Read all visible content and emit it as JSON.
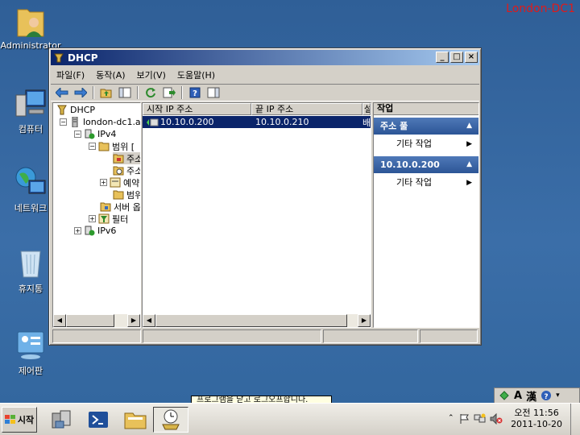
{
  "host_label": "London-DC1",
  "desktop_icons": [
    {
      "label": "Administrator"
    },
    {
      "label": "컴퓨터"
    },
    {
      "label": "네트워크"
    },
    {
      "label": "휴지통"
    },
    {
      "label": "제어판"
    }
  ],
  "window": {
    "title": "DHCP",
    "buttons": {
      "minimize": "_",
      "maximize": "□",
      "close": "×"
    }
  },
  "menu": [
    "파일(F)",
    "동작(A)",
    "보기(V)",
    "도움말(H)"
  ],
  "tree": {
    "root": "DHCP",
    "server": "london-dc1.a",
    "ipv4": "IPv4",
    "scope": "범위 [",
    "address_pool": "주소",
    "leases": "주소",
    "reservations": "예약",
    "scope_options": "범위",
    "server_options": "서버 옵",
    "filters": "필터",
    "ipv6": "IPv6"
  },
  "list": {
    "columns": [
      "시작 IP 주소",
      "끝 IP 주소",
      "설"
    ],
    "rows": [
      {
        "start": "10.10.0.200",
        "end": "10.10.0.210",
        "desc": "배"
      }
    ]
  },
  "actions": {
    "header": "작업",
    "sections": [
      {
        "title": "주소 풀",
        "item": "기타 작업"
      },
      {
        "title": "10.10.0.200",
        "item": "기타 작업"
      }
    ]
  },
  "tooltip": "프로그램을 닫고 로그오프합니다.",
  "language_bar": {
    "mode": "A",
    "hanja": "漢"
  },
  "taskbar": {
    "start_label": "시작",
    "clock_time": "오전 11:56",
    "clock_date": "2011-10-20"
  }
}
